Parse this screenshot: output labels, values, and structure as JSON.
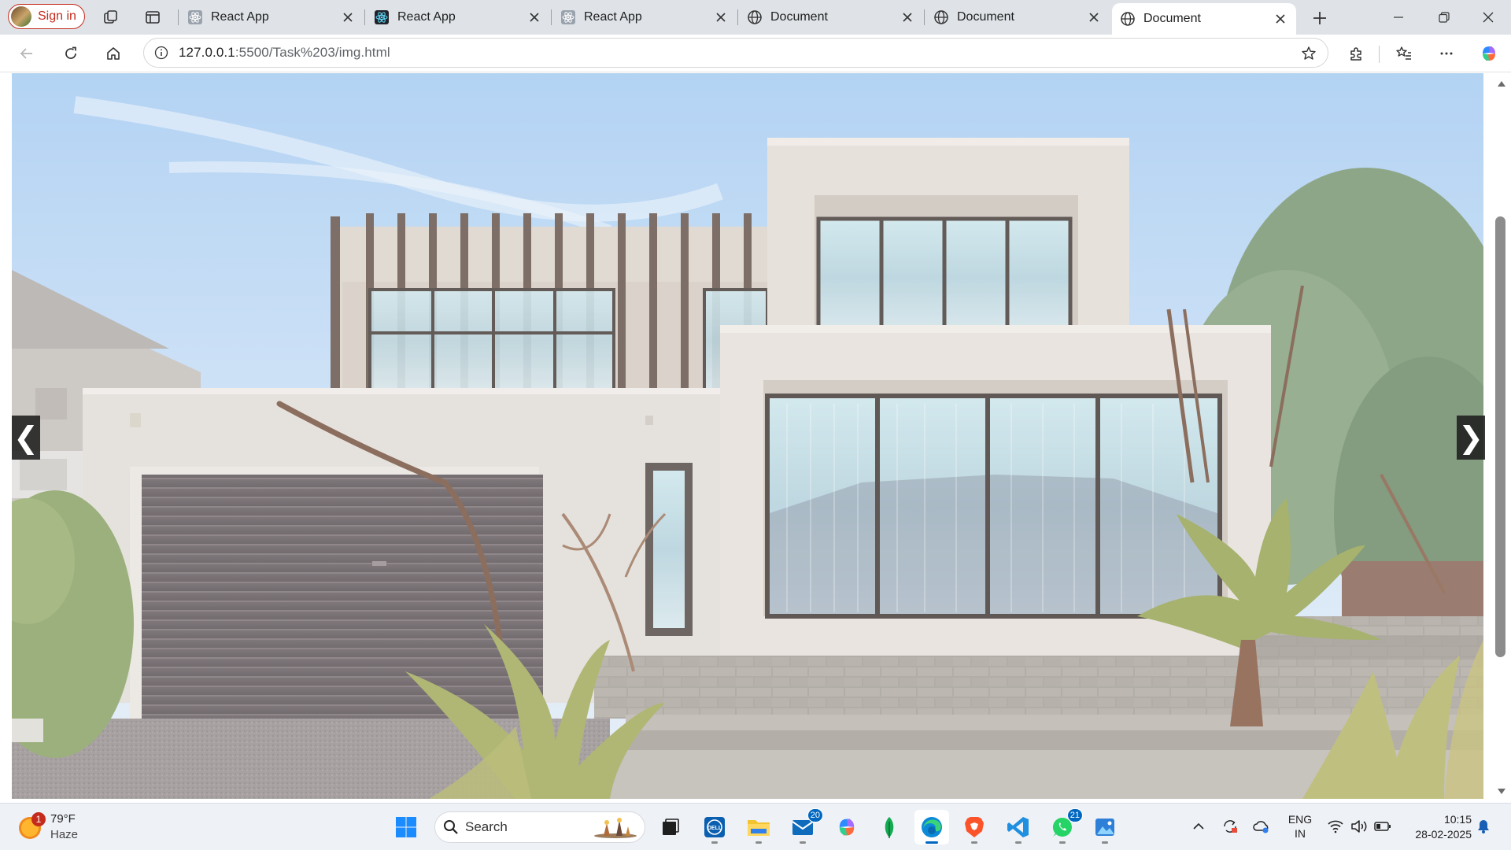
{
  "browser": {
    "signin_label": "Sign in",
    "tabs": [
      {
        "title": "React App",
        "icon": "react-icon",
        "active": false
      },
      {
        "title": "React App",
        "icon": "react-icon",
        "active": false
      },
      {
        "title": "React App",
        "icon": "react-icon",
        "active": false
      },
      {
        "title": "Document",
        "icon": "globe-icon",
        "active": false
      },
      {
        "title": "Document",
        "icon": "globe-icon",
        "active": false
      },
      {
        "title": "Document",
        "icon": "globe-icon",
        "active": true
      }
    ],
    "address": {
      "host": "127.0.0.1",
      "path": ":5500/Task%203/img.html"
    }
  },
  "page": {
    "slider": {
      "prev_label": "❮",
      "next_label": "❯"
    }
  },
  "taskbar": {
    "weather": {
      "alert_count": "1",
      "temperature": "79°F",
      "condition": "Haze"
    },
    "search_label": "Search",
    "apps": [
      {
        "name": "start-button",
        "icon": "windows-logo-icon"
      },
      {
        "name": "taskbar-search",
        "icon": "search-icon"
      },
      {
        "name": "task-view-button",
        "icon": "task-view-icon"
      },
      {
        "name": "dell-app",
        "icon": "dell-icon"
      },
      {
        "name": "file-explorer",
        "icon": "folder-icon"
      },
      {
        "name": "mail-app",
        "icon": "mail-icon",
        "badge": "20"
      },
      {
        "name": "copilot-app",
        "icon": "copilot-icon"
      },
      {
        "name": "mongodb-compass",
        "icon": "leaf-icon"
      },
      {
        "name": "edge-browser",
        "icon": "edge-icon"
      },
      {
        "name": "brave-browser",
        "icon": "brave-icon"
      },
      {
        "name": "vscode",
        "icon": "vscode-icon"
      },
      {
        "name": "whatsapp",
        "icon": "whatsapp-icon",
        "badge": "21"
      },
      {
        "name": "photos-app",
        "icon": "photos-icon"
      }
    ],
    "language": {
      "line1": "ENG",
      "line2": "IN"
    },
    "clock": {
      "time": "10:15",
      "date": "28-02-2025"
    }
  },
  "colors": {
    "accent": "#0067c0",
    "signin_red": "#c42b1c",
    "tabstrip_bg": "#dfe3e8",
    "taskbar_bg": "#eef1f6"
  }
}
